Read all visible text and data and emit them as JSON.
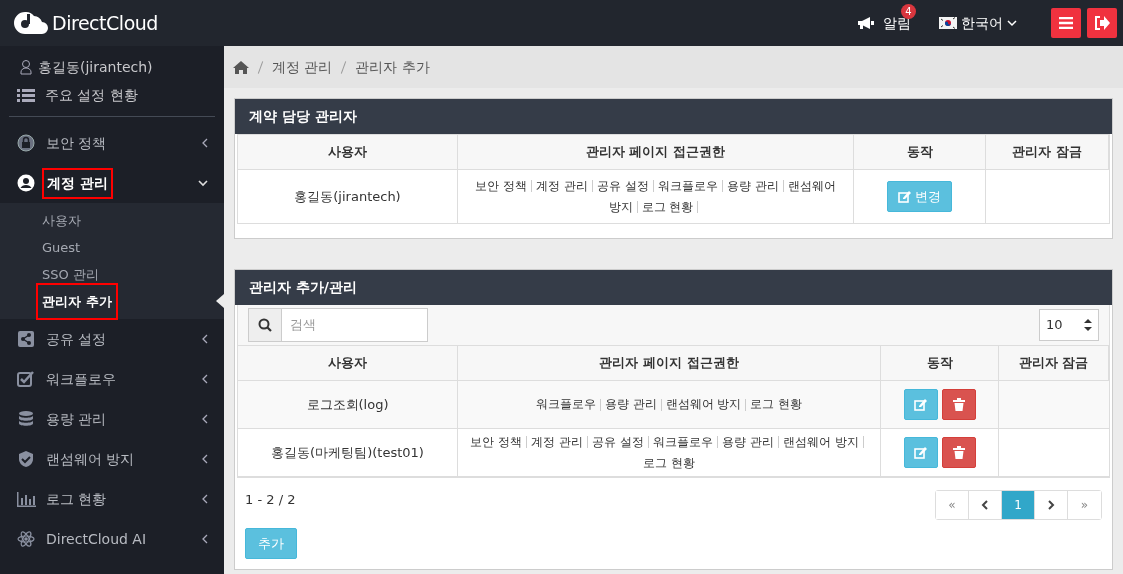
{
  "brand": "DirectCloud",
  "topbar": {
    "notice_label": "알림",
    "notice_count": "4",
    "language": "한국어"
  },
  "sidebar": {
    "user": "홍길동(jirantech)",
    "overview": "주요 설정 현황",
    "items": [
      {
        "label": "보안 정책",
        "expanded": false,
        "highlighted": false
      },
      {
        "label": "계정 관리",
        "expanded": true,
        "highlighted": true,
        "children": [
          {
            "label": "사용자",
            "selected": false,
            "highlighted": false
          },
          {
            "label": "Guest",
            "selected": false,
            "highlighted": false
          },
          {
            "label": "SSO 관리",
            "selected": false,
            "highlighted": false
          },
          {
            "label": "관리자 추가",
            "selected": true,
            "highlighted": true
          }
        ]
      },
      {
        "label": "공유 설정",
        "expanded": false,
        "highlighted": false
      },
      {
        "label": "워크플로우",
        "expanded": false,
        "highlighted": false
      },
      {
        "label": "용량 관리",
        "expanded": false,
        "highlighted": false
      },
      {
        "label": "랜섬웨어 방지",
        "expanded": false,
        "highlighted": false
      },
      {
        "label": "로그 현황",
        "expanded": false,
        "highlighted": false
      },
      {
        "label": "DirectCloud AI",
        "expanded": false,
        "highlighted": false
      }
    ]
  },
  "breadcrumb": [
    "계정 관리",
    "관리자 추가"
  ],
  "contract_panel": {
    "title": "계약 담당 관리자",
    "columns": [
      "사용자",
      "관리자 페이지 접근권한",
      "동작",
      "관리자 잠금"
    ],
    "rows": [
      {
        "user": "홍길동(jirantech)",
        "permissions": [
          "보안 정책",
          "계정 관리",
          "공유 설정",
          "워크플로우",
          "용량 관리",
          "랜섬웨어 방지",
          "로그 현황"
        ],
        "trailing_separator": true,
        "action": "변경"
      }
    ]
  },
  "admin_panel": {
    "title": "관리자 추가/관리",
    "search_placeholder": "검색",
    "page_size": "10",
    "columns": [
      "사용자",
      "관리자 페이지 접근권한",
      "동작",
      "관리자 잠금"
    ],
    "rows": [
      {
        "user": "로그조회(log)",
        "permissions": [
          "워크플로우",
          "용량 관리",
          "랜섬웨어 방지",
          "로그 현황"
        ],
        "trailing_separator": false
      },
      {
        "user": "홍길동(마케팅팀)(test01)",
        "permissions": [
          "보안 정책",
          "계정 관리",
          "공유 설정",
          "워크플로우",
          "용량 관리",
          "랜섬웨어 방지",
          "로그 현황"
        ],
        "trailing_separator": false
      }
    ],
    "range": "1 - 2 / 2",
    "pages": [
      {
        "label": "«",
        "kind": "first",
        "selected": false
      },
      {
        "kind": "prev",
        "selected": false
      },
      {
        "label": "1",
        "kind": "page",
        "selected": true
      },
      {
        "kind": "next",
        "selected": false
      },
      {
        "label": "»",
        "kind": "last",
        "selected": false
      }
    ],
    "add_button": "추가"
  }
}
